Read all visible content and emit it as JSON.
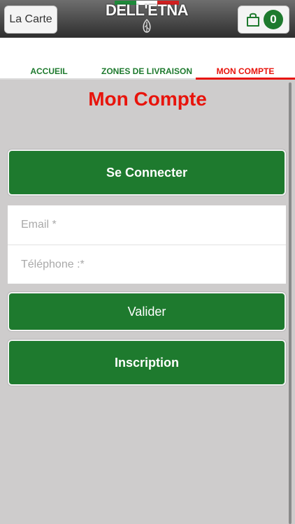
{
  "header": {
    "menu_button_label": "La Carte",
    "logo_text": "DELL'ETNA",
    "cart_count": "0",
    "flag_colors": [
      "#1e8a3a",
      "#ffffff",
      "#d21f1f"
    ]
  },
  "tabs": [
    {
      "label": "ACCUEIL",
      "active": false
    },
    {
      "label": "ZONES DE LIVRAISON",
      "active": false
    },
    {
      "label": "MON COMPTE",
      "active": true
    }
  ],
  "main": {
    "title": "Mon Compte",
    "connect_button": "Se Connecter",
    "email_placeholder": "Email *",
    "phone_placeholder": "Téléphone :*",
    "validate_button": "Valider",
    "signup_button": "Inscription"
  },
  "colors": {
    "accent_green": "#1e7a2e",
    "accent_red": "#e8140c",
    "background": "#cecccc"
  }
}
